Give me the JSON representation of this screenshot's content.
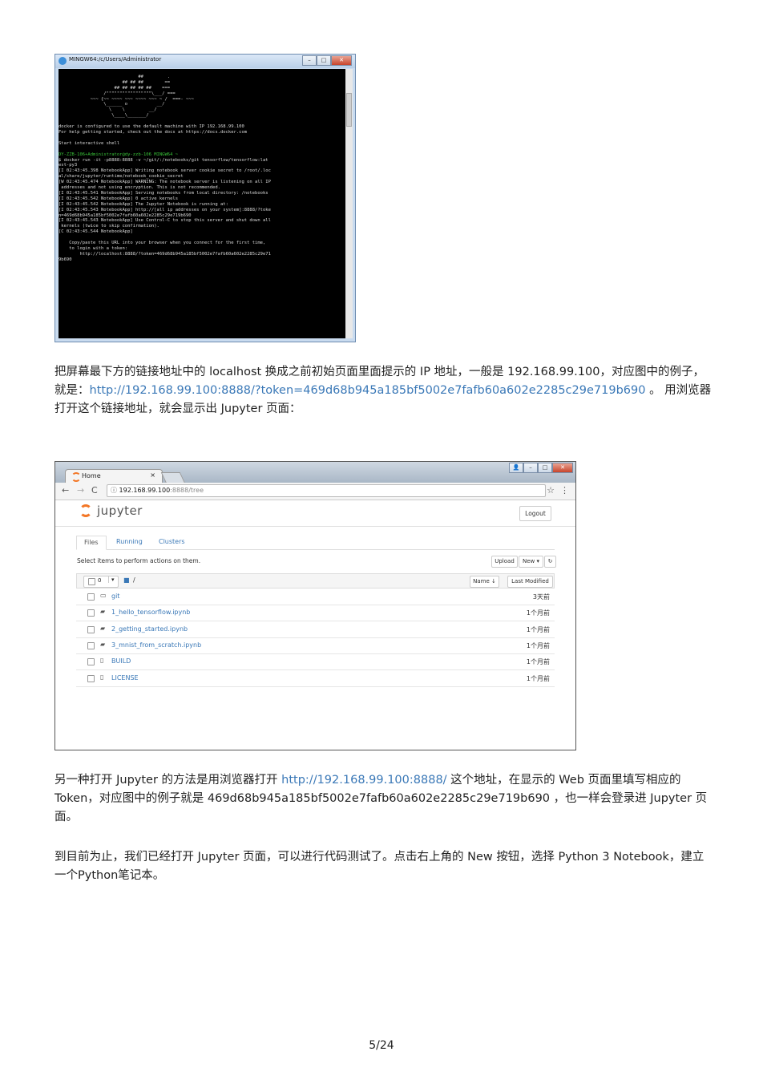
{
  "terminal": {
    "title": "MINGW64:/c/Users/Administrator",
    "lines": [
      "",
      "                              ##         .",
      "                        ## ## ##        ==",
      "                     ## ## ## ## ##    ===",
      "                 /\"\"\"\"\"\"\"\"\"\"\"\"\"\"\"\"\"\\___/ ===",
      "            ~~~ {~~ ~~~~ ~~~ ~~~~ ~~~ ~ /  ===- ~~~",
      "                 \\______ o           __/",
      "                   \\    \\         __/",
      "                    \\____\\_______/",
      "",
      "docker is configured to use the default machine with IP 192.168.99.100",
      "For help getting started, check out the docs at https://docs.docker.com",
      "",
      "Start interactive shell",
      "",
      "DY-ZZB-106+Administrator@dy-zzb-106 MINGW64 ~",
      "$ docker run -it -p8888:8888 -v ~/git/:/notebooks/git tensorflow/tensorflow:lat",
      "est-py3",
      "[I 02:43:45.398 NotebookApp] Writing notebook server cookie secret to /root/.loc",
      "al/share/jupyter/runtime/notebook_cookie_secret",
      "[W 02:43:45.474 NotebookApp] WARNING: The notebook server is listening on all IP",
      " addresses and not using encryption. This is not recommended.",
      "[I 02:43:45.541 NotebookApp] Serving notebooks from local directory: /notebooks",
      "[I 02:43:45.542 NotebookApp] 0 active kernels",
      "[I 02:43:45.542 NotebookApp] The Jupyter Notebook is running at:",
      "[I 02:43:45.543 NotebookApp] http://[all ip addresses on your system]:8888/?toke",
      "n=469d68b945a185bf5002e7fafb60a602e2285c29e719b690",
      "[I 02:43:45.543 NotebookApp] Use Control-C to stop this server and shut down all",
      " kernels (twice to skip confirmation).",
      "[C 02:43:45.544 NotebookApp]",
      "",
      "    Copy/paste this URL into your browser when you connect for the first time,",
      "    to login with a token:",
      "        http://localhost:8888/?token=469d68b945a185bf5002e7fafb60a602e2285c29e71",
      "9b690"
    ]
  },
  "para1": {
    "text_a": "把屏幕最下方的链接地址中的 localhost 换成之前初始页面里面提示的 IP 地址，一般是 192.168.99.100，对应图中的例子，就是：",
    "link": "http://192.168.99.100:8888/?token=469d68b945a185bf5002e7fafb60a602e2285c29e719b690",
    "text_b": " 。 用浏览器打开这个链接地址，就会显示出 Jupyter 页面："
  },
  "browser": {
    "tab_label": "Home",
    "tab_close": "×",
    "url_info": "ⓘ",
    "url_host": "192.168.99.100",
    "url_path": ":8888/tree",
    "brand": "jupyter",
    "logout": "Logout",
    "tabs": [
      "Files",
      "Running",
      "Clusters"
    ],
    "select_hint": "Select items to perform actions on them.",
    "upload": "Upload",
    "new": "New ▾",
    "refresh": "↻",
    "count": "0",
    "path_root": "/",
    "sort_name": "Name ↓",
    "last_modified": "Last Modified",
    "rows": [
      {
        "name": "git",
        "time": "3天前",
        "kind": "folder"
      },
      {
        "name": "1_hello_tensorflow.ipynb",
        "time": "1个月前",
        "kind": "notebook"
      },
      {
        "name": "2_getting_started.ipynb",
        "time": "1个月前",
        "kind": "notebook"
      },
      {
        "name": "3_mnist_from_scratch.ipynb",
        "time": "1个月前",
        "kind": "notebook"
      },
      {
        "name": "BUILD",
        "time": "1个月前",
        "kind": "file"
      },
      {
        "name": "LICENSE",
        "time": "1个月前",
        "kind": "file"
      }
    ]
  },
  "para2": {
    "text_a": "另一种打开 Jupyter 的方法是用浏览器打开 ",
    "link": "http://192.168.99.100:8888/",
    "text_b": " 这个地址，在显示的 Web 页面里填写相应的 Token，对应图中的例子就是 469d68b945a185bf5002e7fafb60a602e2285c29e719b690 ，也一样会登录进 Jupyter 页面。"
  },
  "para3": {
    "text": "到目前为止，我们已经打开 Jupyter 页面，可以进行代码测试了。点击右上角的 New 按钮，选择 Python 3 Notebook，建立一个Python笔记本。"
  },
  "page_number": "5/24",
  "colors": {
    "link": "#3a78b7",
    "jupyter_orange": "#f37726"
  }
}
